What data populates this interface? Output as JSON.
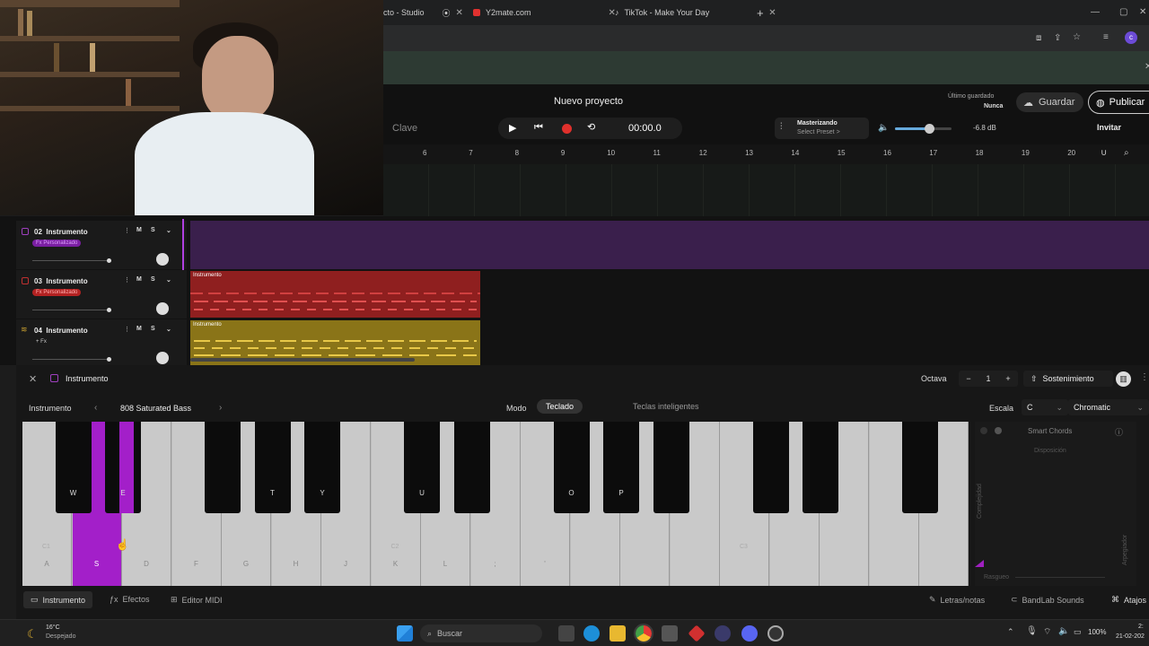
{
  "browser": {
    "tabs": [
      {
        "label": "cto - Studio"
      },
      {
        "label": "Y2mate.com"
      },
      {
        "label": "TikTok - Make Your Day"
      }
    ],
    "new_tab": "+"
  },
  "header": {
    "project_title": "Nuevo proyecto",
    "last_saved_label": "Último guardado",
    "last_saved_value": "Nunca",
    "save_label": "Guardar",
    "publish_label": "Publicar",
    "key_label": "Clave",
    "time": "00:00.0",
    "mastering_label": "Masterizando",
    "mastering_sub": "Select Preset >",
    "db": "-6.8 dB",
    "invite_label": "Invitar",
    "volume_level": 0.6
  },
  "ruler": {
    "numbers": [
      "6",
      "7",
      "8",
      "9",
      "10",
      "11",
      "12",
      "13",
      "14",
      "15",
      "16",
      "17",
      "18",
      "19",
      "20"
    ]
  },
  "tracks": [
    {
      "number": "02",
      "name": "Instrumento",
      "fx": "Fx Personalizado",
      "fx_color": "#7a1fa2",
      "m": "M",
      "s": "S"
    },
    {
      "number": "03",
      "name": "Instrumento",
      "fx": "Fx Personalizado",
      "fx_color": "#b32222",
      "m": "M",
      "s": "S",
      "region_label": "Instrumento"
    },
    {
      "number": "04",
      "name": "Instrumento",
      "fx": "+ Fx",
      "fx_color": "transparent",
      "m": "M",
      "s": "S",
      "region_label": "Instrumento"
    }
  ],
  "panel": {
    "title": "Instrumento",
    "octave_label": "Octava",
    "octave_value": "1",
    "minus": "−",
    "plus": "+",
    "sustain_label": "Sostenimiento",
    "instrument_label": "Instrumento",
    "preset_name": "808 Saturated Bass",
    "mode_label": "Modo",
    "mode_keyboard": "Teclado",
    "mode_smart": "Teclas inteligentes",
    "scale_label": "Escala",
    "scale_key": "C",
    "scale_type": "Chromatic",
    "smart_chords": "Smart Chords",
    "disposition": "Disposición",
    "complexity": "Complejidad",
    "roughness": "Rasgueo",
    "arpeggiator": "Arpegiador"
  },
  "keyboard": {
    "white_keys": [
      "A",
      "S",
      "D",
      "F",
      "G",
      "H",
      "J",
      "K",
      "L",
      ";",
      "'",
      "",
      "",
      "",
      "",
      "",
      "",
      "",
      ""
    ],
    "octave_markers": {
      "c1": "C1",
      "c2": "C2",
      "c3": "C3"
    },
    "black_keys": [
      "W",
      "E",
      "",
      "T",
      "Y",
      "U",
      "",
      "O",
      "P",
      "",
      "",
      "",
      "",
      "",
      "",
      ""
    ],
    "active_key": "S"
  },
  "bottom_tabs": {
    "instrument": "Instrumento",
    "effects": "Efectos",
    "midi": "Editor MIDI",
    "lyrics": "Letras/notas",
    "sounds": "BandLab Sounds",
    "shortcuts": "Atajos"
  },
  "taskbar": {
    "temp": "16°C",
    "weather": "Despejado",
    "search": "Buscar",
    "battery": "100%",
    "time": "2:",
    "date": "21-02-202"
  }
}
